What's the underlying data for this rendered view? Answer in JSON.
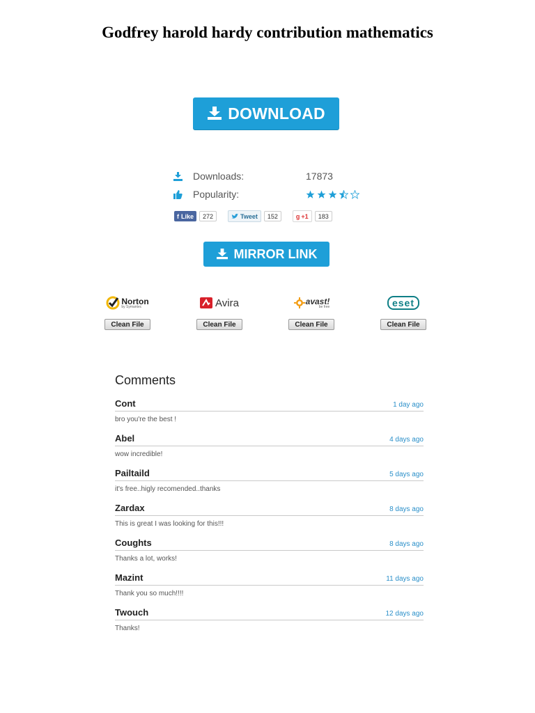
{
  "page": {
    "title": "Godfrey harold hardy contribution mathematics"
  },
  "download_button": {
    "label": "DOWNLOAD",
    "icon": "download-icon",
    "color": "#1e9fd8"
  },
  "stats": {
    "downloads_label": "Downloads:",
    "downloads_value": "17873",
    "popularity_label": "Popularity:",
    "rating": 3.5,
    "rating_max": 5
  },
  "social": {
    "facebook": {
      "label": "Like",
      "count": "272"
    },
    "twitter": {
      "label": "Tweet",
      "count": "152"
    },
    "gplus": {
      "label": "+1",
      "count": "183"
    }
  },
  "mirror_button": {
    "label": "MIRROR LINK",
    "icon": "download-icon"
  },
  "antivirus": [
    {
      "name": "Norton",
      "sub": "by Symantec",
      "button": "Clean File"
    },
    {
      "name": "Avira",
      "button": "Clean File"
    },
    {
      "name": "avast!",
      "sub": "be free",
      "button": "Clean File"
    },
    {
      "name": "eset",
      "button": "Clean File"
    }
  ],
  "comments": {
    "title": "Comments",
    "items": [
      {
        "author": "Cont",
        "time": "1 day ago",
        "text": "bro you're the best !"
      },
      {
        "author": "Abel",
        "time": "4 days ago",
        "text": "wow incredible!"
      },
      {
        "author": "Pailtaild",
        "time": "5 days ago",
        "text": "it's free..higly recomended..thanks"
      },
      {
        "author": "Zardax",
        "time": "8 days ago",
        "text": "This is great I was looking for this!!!"
      },
      {
        "author": "Coughts",
        "time": "8 days ago",
        "text": "Thanks a lot, works!"
      },
      {
        "author": "Mazint",
        "time": "11 days ago",
        "text": "Thank you so much!!!!"
      },
      {
        "author": "Twouch",
        "time": "12 days ago",
        "text": "Thanks!"
      }
    ]
  }
}
